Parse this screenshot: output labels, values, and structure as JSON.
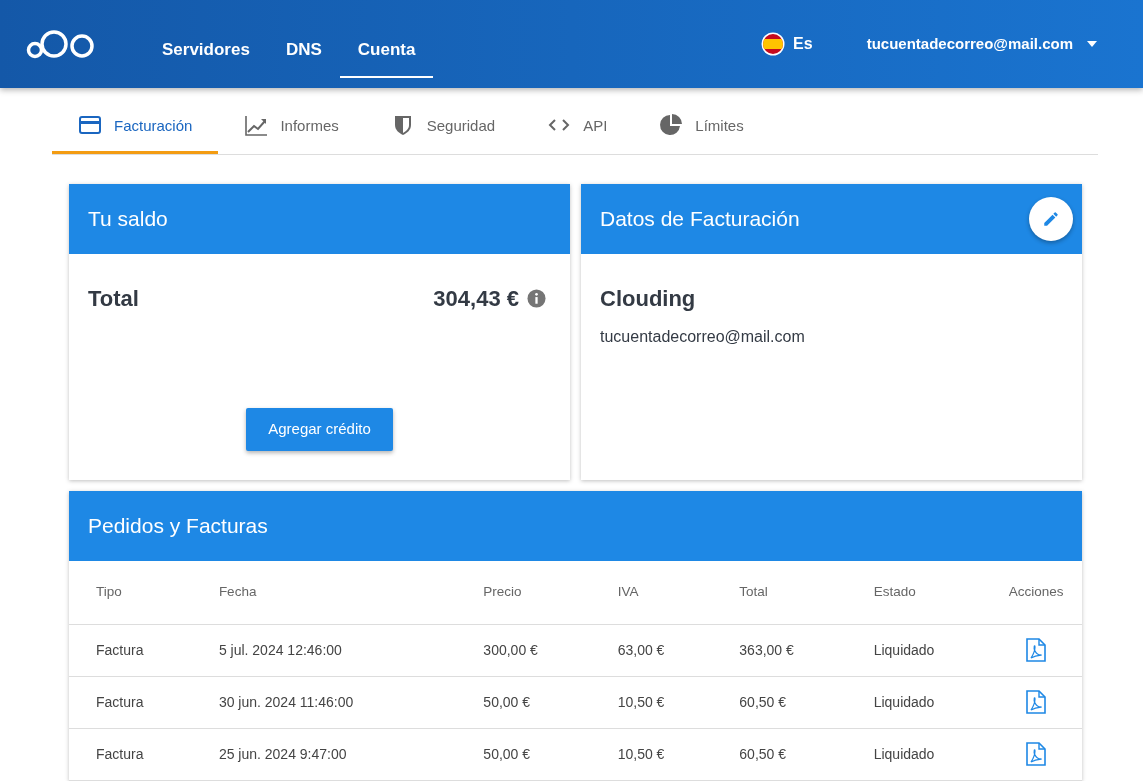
{
  "nav": {
    "items": [
      {
        "label": "Servidores",
        "selected": false
      },
      {
        "label": "DNS",
        "selected": false
      },
      {
        "label": "Cuenta",
        "selected": true
      }
    ],
    "language": "Es",
    "account": "tucuentadecorreo@mail.com"
  },
  "tabs": [
    {
      "label": "Facturación",
      "selected": true
    },
    {
      "label": "Informes",
      "selected": false
    },
    {
      "label": "Seguridad",
      "selected": false
    },
    {
      "label": "API",
      "selected": false
    },
    {
      "label": "Límites",
      "selected": false
    }
  ],
  "balance": {
    "title": "Tu saldo",
    "label": "Total",
    "amount": "304,43 €",
    "button": "Agregar crédito"
  },
  "billing": {
    "title": "Datos de Facturación",
    "name": "Clouding",
    "email": "tucuentadecorreo@mail.com"
  },
  "orders": {
    "title": "Pedidos y Facturas",
    "columns": [
      "Tipo",
      "Fecha",
      "Precio",
      "IVA",
      "Total",
      "Estado",
      "Acciones"
    ],
    "rows": [
      [
        "Factura",
        "5 jul. 2024 12:46:00",
        "300,00 €",
        "63,00 €",
        "363,00 €",
        "Liquidado"
      ],
      [
        "Factura",
        "30 jun. 2024 11:46:00",
        "50,00 €",
        "10,50 €",
        "60,50 €",
        "Liquidado"
      ],
      [
        "Factura",
        "25 jun. 2024 9:47:00",
        "50,00 €",
        "10,50 €",
        "60,50 €",
        "Liquidado"
      ]
    ]
  }
}
